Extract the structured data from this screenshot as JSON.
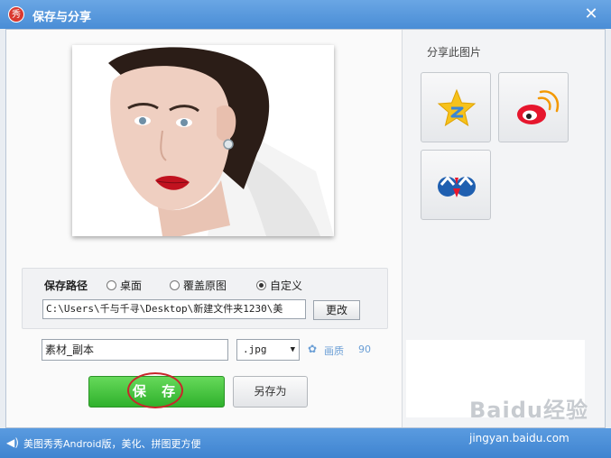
{
  "window": {
    "title": "保存与分享",
    "logo_text": "秀",
    "close_glyph": "✕"
  },
  "save_path": {
    "label": "保存路径",
    "options": [
      {
        "label": "桌面",
        "selected": false
      },
      {
        "label": "覆盖原图",
        "selected": false
      },
      {
        "label": "自定义",
        "selected": true
      }
    ],
    "path_value": "C:\\Users\\千与千寻\\Desktop\\新建文件夹1230\\美",
    "change_label": "更改"
  },
  "file": {
    "name_value": "素材_副本",
    "extension": ".jpg",
    "quality_label": "画质",
    "quality_value": "90"
  },
  "buttons": {
    "save_label": "保 存",
    "save_as_label": "另存为"
  },
  "share": {
    "label": "分享此图片",
    "targets": [
      {
        "icon": "qzone-icon"
      },
      {
        "icon": "weibo-icon"
      },
      {
        "icon": "renren-icon"
      }
    ]
  },
  "status_bar": {
    "text": "美图秀秀Android版，美化、拼图更方便",
    "speaker_icon": "speaker-icon"
  },
  "watermark": {
    "brand": "Baidu经验",
    "url": "jingyan.baidu.com"
  },
  "colors": {
    "titlebar": "#4a8dd6",
    "save_button": "#2fb12c",
    "highlight_ring": "#c8262b",
    "link": "#6b9fd6"
  }
}
